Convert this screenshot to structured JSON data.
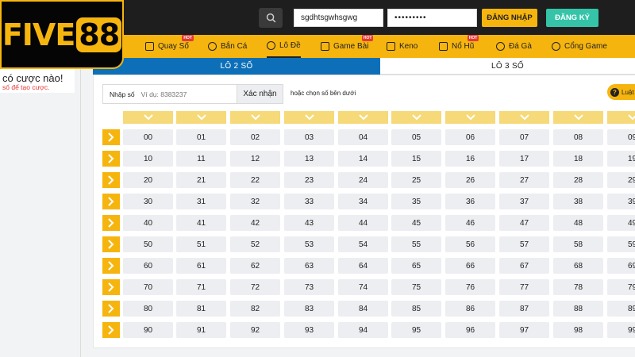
{
  "header": {
    "username": "sgdhtsgwhsgwg",
    "password_masked": "•••••••••",
    "login_label": "ĐĂNG NHẬP",
    "register_label": "ĐĂNG KÝ"
  },
  "logo": {
    "brand": "FIVE88",
    "part1": "FIVE",
    "part2": "88"
  },
  "nav": {
    "items": [
      {
        "label": "Quay Số",
        "icon": "dice-icon",
        "hot": true
      },
      {
        "label": "Bắn Cá",
        "icon": "fish-icon",
        "hot": false
      },
      {
        "label": "Lô Đề",
        "icon": "lottery-icon",
        "hot": false,
        "active": true
      },
      {
        "label": "Game Bài",
        "icon": "cards-icon",
        "hot": true
      },
      {
        "label": "Keno",
        "icon": "keno-icon",
        "hot": false
      },
      {
        "label": "Nổ Hũ",
        "icon": "slot-icon",
        "hot": true
      },
      {
        "label": "Đá Gà",
        "icon": "rooster-icon",
        "hot": false
      },
      {
        "label": "Cổng Game",
        "icon": "gamepad-icon",
        "hot": false
      }
    ],
    "hot_label": "HOT"
  },
  "sidebar": {
    "title": "có cược nào!",
    "subtitle": "số để tạo cược."
  },
  "tabs": [
    {
      "label": "LÔ 2 SỐ",
      "active": true
    },
    {
      "label": "LÔ 3 SỐ",
      "active": false
    }
  ],
  "entry": {
    "label": "Nhập số",
    "placeholder": "Ví dụ: 8383237",
    "confirm_label": "Xác nhận",
    "hint_prefix": "hoặc",
    "hint_text": "chọn số bên dưới",
    "rules_label": "Luật"
  },
  "grid": {
    "rows": [
      [
        "00",
        "01",
        "02",
        "03",
        "04",
        "05",
        "06",
        "07",
        "08",
        "09"
      ],
      [
        "10",
        "11",
        "12",
        "13",
        "14",
        "15",
        "16",
        "17",
        "18",
        "19"
      ],
      [
        "20",
        "21",
        "22",
        "23",
        "24",
        "25",
        "26",
        "27",
        "28",
        "29"
      ],
      [
        "30",
        "31",
        "32",
        "33",
        "34",
        "35",
        "36",
        "37",
        "38",
        "39"
      ],
      [
        "40",
        "41",
        "42",
        "43",
        "44",
        "45",
        "46",
        "47",
        "48",
        "49"
      ],
      [
        "50",
        "51",
        "52",
        "53",
        "54",
        "55",
        "56",
        "57",
        "58",
        "59"
      ],
      [
        "60",
        "61",
        "62",
        "63",
        "64",
        "65",
        "66",
        "67",
        "68",
        "69"
      ],
      [
        "70",
        "71",
        "72",
        "73",
        "74",
        "75",
        "76",
        "77",
        "78",
        "79"
      ],
      [
        "80",
        "81",
        "82",
        "83",
        "84",
        "85",
        "86",
        "87",
        "88",
        "89"
      ],
      [
        "90",
        "91",
        "92",
        "93",
        "94",
        "95",
        "96",
        "97",
        "98",
        "99"
      ]
    ]
  },
  "colors": {
    "brand_yellow": "#f6b50e",
    "header_dark": "#1e1e1e",
    "tab_blue": "#0d6fb8",
    "register_teal": "#35c4a8",
    "cell_gray": "#eceef1",
    "column_head": "#f6d978"
  }
}
